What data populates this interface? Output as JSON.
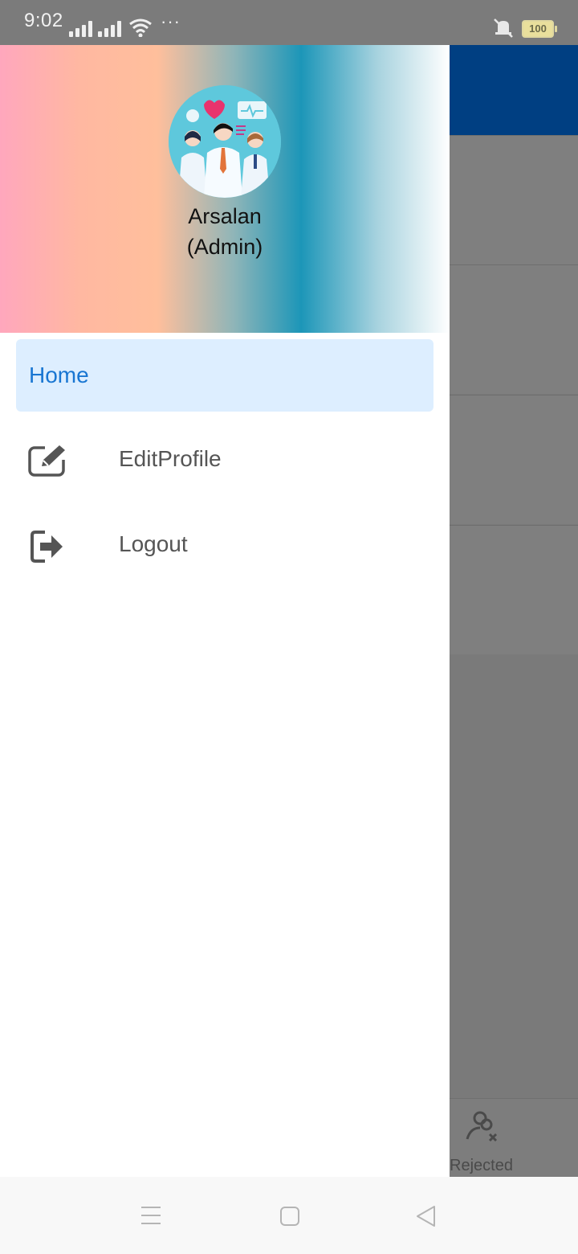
{
  "status_bar": {
    "time": "9:02",
    "more": "···",
    "battery": "100"
  },
  "drawer": {
    "user_name": "Arsalan",
    "user_role": "(Admin)",
    "menu": {
      "home_label": "Home",
      "edit_profile_label": "EditProfile",
      "logout_label": "Logout"
    }
  },
  "background_app": {
    "appbar_color": "#003f82",
    "bottom_nav_item_label": "Rejected"
  },
  "colors": {
    "accent": "#1976d2",
    "selected_bg": "#ddeeff"
  },
  "icons": {
    "edit": "edit-square-icon",
    "logout": "logout-icon",
    "rejected": "user-rejected-icon"
  }
}
